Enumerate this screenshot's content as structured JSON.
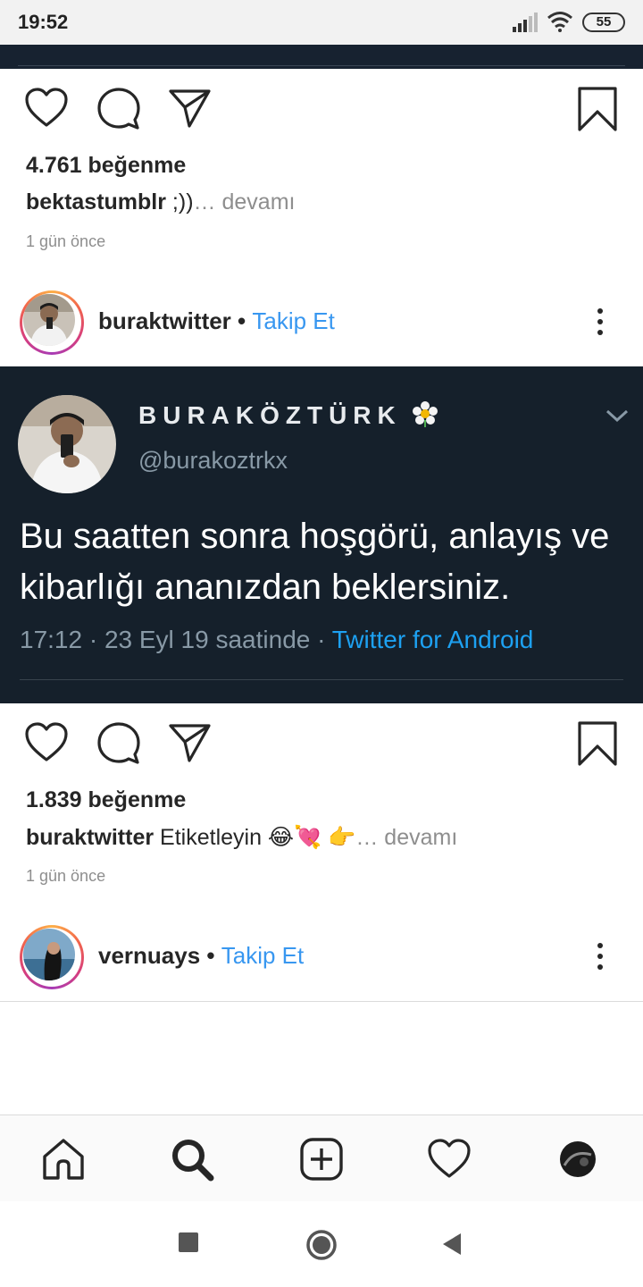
{
  "status_bar": {
    "time": "19:52",
    "battery": "55"
  },
  "post1": {
    "likes": "4.761 beğenme",
    "caption_user": "bektastumblr",
    "caption_text": " ;))",
    "more": "… devamı",
    "time_ago": "1 gün önce"
  },
  "post2": {
    "username": "buraktwitter",
    "separator": " • ",
    "follow": "Takip Et",
    "tweet": {
      "display_name": "BURAKÖZTÜRK",
      "handle": "@burakoztrkx",
      "text": "Bu saatten sonra hoşgörü, anlayış ve kibarlığı ananızdan beklersiniz.",
      "timestamp": "17:12 · 23 Eyl 19 saatinde · ",
      "source": "Twitter for Android"
    },
    "likes": "1.839 beğenme",
    "caption_user": "buraktwitter",
    "caption_text": " Etiketleyin 😂💘 👉",
    "more": "… devamı",
    "time_ago": "1 gün önce"
  },
  "post3": {
    "username": "vernuays",
    "separator": " • ",
    "follow": "Takip Et"
  },
  "tab_bar": {
    "items": [
      "home-icon",
      "search-icon",
      "new-post-icon",
      "activity-heart-icon",
      "profile-avatar"
    ]
  },
  "colors": {
    "follow_link": "#3897f0",
    "tweet_bg": "#15202b",
    "twitter_blue": "#1da1f2"
  }
}
